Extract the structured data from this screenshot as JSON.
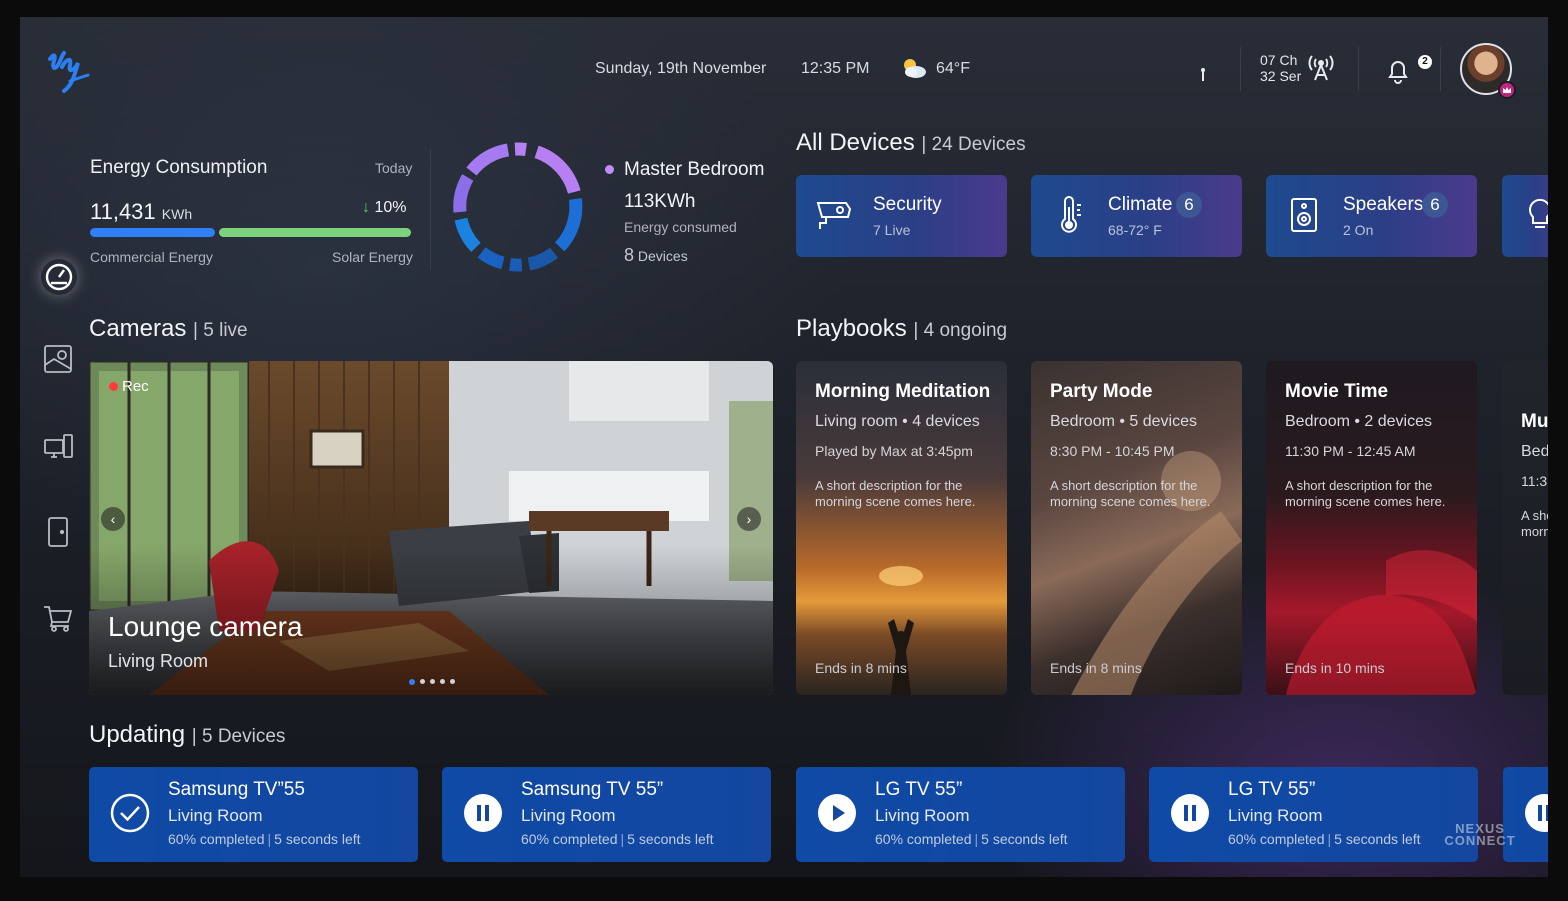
{
  "header": {
    "date": "Sunday, 19th November",
    "time": "12:35 PM",
    "weather": "64°F",
    "channel_line1": "07 Ch",
    "channel_line2": "32 Ser",
    "notification_count": "2"
  },
  "energy": {
    "title": "Energy Consumption",
    "period": "Today",
    "value": "11,431",
    "unit": "KWh",
    "change": "10%",
    "left_label": "Commercial Energy",
    "right_label": "Solar Energy",
    "ring_room": "Master Bedroom",
    "ring_value": "113KWh",
    "ring_caption": "Energy consumed",
    "ring_devices_count": "8",
    "ring_devices_label": "Devices",
    "colors": {
      "commercial": "#2f7ff5",
      "solar": "#7cd37c",
      "ring_accent": "#b67ff2"
    }
  },
  "all_devices": {
    "title": "All Devices",
    "subtitle": "24 Devices",
    "items": [
      {
        "name": "Security",
        "info": "7 Live",
        "count": "",
        "icon": "camera-icon"
      },
      {
        "name": "Climate",
        "info": "68-72° F",
        "count": "6",
        "icon": "thermometer-icon"
      },
      {
        "name": "Speakers",
        "info": "2 On",
        "count": "6",
        "icon": "speaker-icon"
      }
    ]
  },
  "cameras": {
    "title": "Cameras",
    "subtitle": "5 live",
    "rec_label": "Rec",
    "camera_name": "Lounge camera",
    "camera_room": "Living Room"
  },
  "playbooks": {
    "title": "Playbooks",
    "subtitle": "4 ongoing",
    "items": [
      {
        "title": "Morning Meditation",
        "room": "Living room • 4 devices",
        "played": "Played by Max at 3:45pm",
        "desc": "A short description for the morning scene comes here.",
        "ends": "Ends in 8 mins"
      },
      {
        "title": "Party Mode",
        "room": "Bedroom • 5 devices",
        "played": "8:30 PM - 10:45 PM",
        "desc": "A short description for the morning scene comes here.",
        "ends": "Ends in 8 mins"
      },
      {
        "title": "Movie Time",
        "room": "Bedroom • 2 devices",
        "played": "11:30 PM - 12:45 AM",
        "desc": "A short description for the morning scene comes here.",
        "ends": "Ends in 10 mins"
      },
      {
        "title": "Mu",
        "room": "Bed",
        "played": "11:3",
        "desc": "A sho morn",
        "ends": ""
      }
    ]
  },
  "updating": {
    "title": "Updating",
    "subtitle": "5 Devices",
    "items": [
      {
        "name": "Samsung TV”55",
        "room": "Living Room",
        "progress": "60% completed",
        "left": "5 seconds left",
        "icon": "check-circle-icon"
      },
      {
        "name": "Samsung TV 55”",
        "room": "Living Room",
        "progress": "60% completed",
        "left": "5 seconds left",
        "icon": "pause-circle-icon"
      },
      {
        "name": "LG TV 55”",
        "room": "Living Room",
        "progress": "60% completed",
        "left": "5 seconds left",
        "icon": "play-circle-icon"
      },
      {
        "name": "LG TV 55”",
        "room": "Living Room",
        "progress": "60% completed",
        "left": "5 seconds left",
        "icon": "pause-circle-icon"
      }
    ]
  },
  "watermark": "NEXUS CONNECT"
}
